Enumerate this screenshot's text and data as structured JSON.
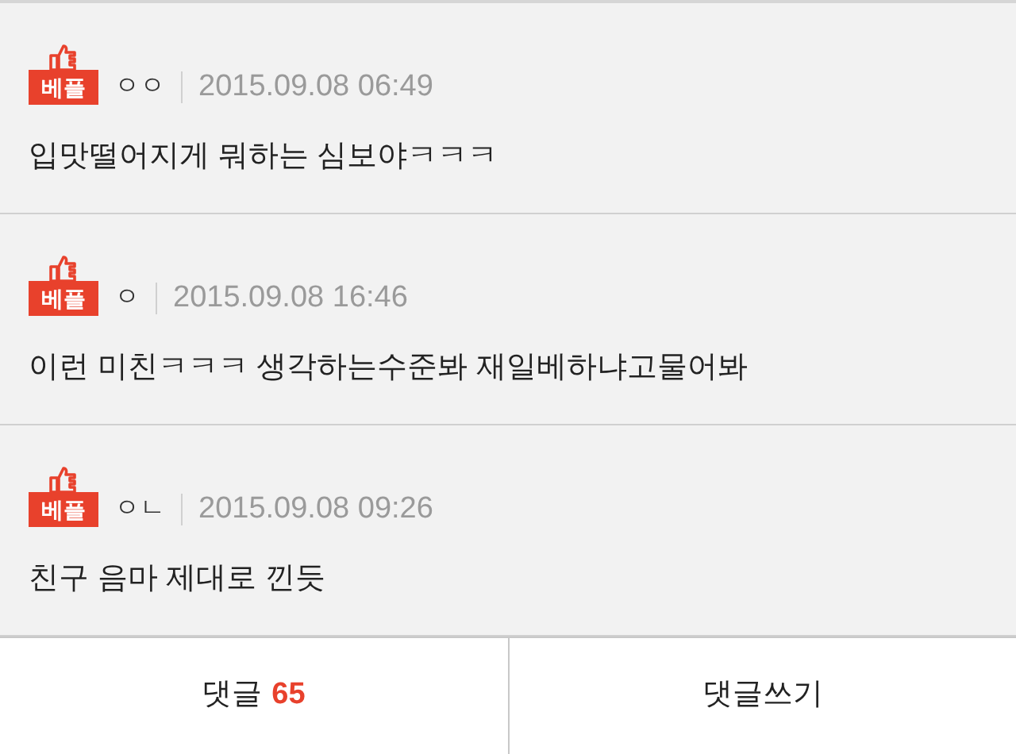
{
  "comments": [
    {
      "badge": "베플",
      "author": "ㅇㅇ",
      "date": "2015.09.08 06:49",
      "text": "입맛떨어지게 뭐하는 심보야ㅋㅋㅋ"
    },
    {
      "badge": "베플",
      "author": "ㅇ",
      "date": "2015.09.08 16:46",
      "text": "이런 미친ㅋㅋㅋ 생각하는수준봐 재일베하냐고물어봐"
    },
    {
      "badge": "베플",
      "author": "ㅇㄴ",
      "date": "2015.09.08 09:26",
      "text": "친구 음마 제대로 낀듯"
    }
  ],
  "footer": {
    "comments_label": "댓글",
    "comments_count": "65",
    "write_label": "댓글쓰기"
  }
}
